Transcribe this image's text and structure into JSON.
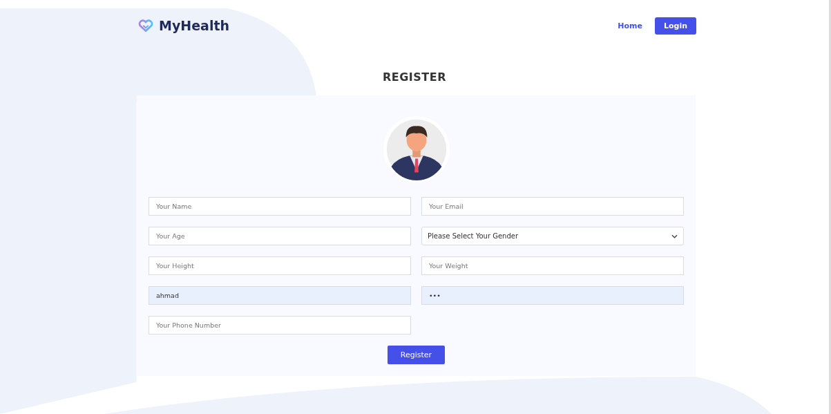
{
  "brand": {
    "name": "MyHealth"
  },
  "nav": [
    {
      "label": "Home",
      "kind": "link"
    },
    {
      "label": "Login",
      "kind": "button"
    }
  ],
  "title": "REGISTER",
  "fields": [
    {
      "kind": "input",
      "placeholder": "Your Name",
      "autofilled": false
    },
    {
      "kind": "input",
      "placeholder": "Your Email",
      "autofilled": false
    },
    {
      "kind": "input",
      "placeholder": "Your Age",
      "autofilled": false
    },
    {
      "kind": "select",
      "value": "Please Select Your Gender",
      "autofilled": false
    },
    {
      "kind": "input",
      "placeholder": "Your Height",
      "autofilled": false
    },
    {
      "kind": "input",
      "placeholder": "Your Weight",
      "autofilled": false
    },
    {
      "kind": "input",
      "value": "ahmad",
      "autofilled": true
    },
    {
      "kind": "password",
      "value": "•••",
      "autofilled": true
    },
    {
      "kind": "input",
      "placeholder": "Your Phone Number",
      "autofilled": false
    }
  ],
  "submit": "Register"
}
